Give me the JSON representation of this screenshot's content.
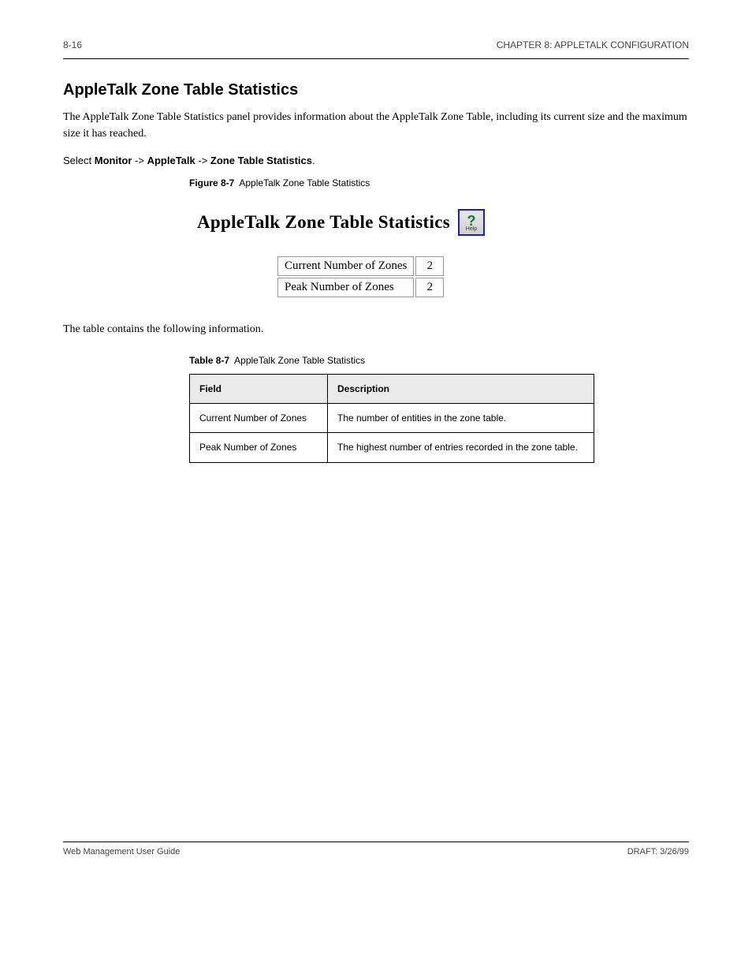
{
  "header": {
    "left": "8-16",
    "right": "CHAPTER 8: APPLETALK CONFIGURATION"
  },
  "section": {
    "title": "AppleTalk Zone Table Statistics",
    "intro": "The AppleTalk Zone Table Statistics panel provides information about the AppleTalk Zone Table, including its current size and the maximum size it has reached.",
    "nav": {
      "prefix": "Select ",
      "m1": "Monitor",
      "arrow": " -> ",
      "m2": "AppleTalk",
      "m3": "Zone Table Statistics"
    }
  },
  "figure": {
    "label": "Figure 8-7",
    "caption": "AppleTalk Zone Table Statistics",
    "panel_title": "AppleTalk Zone Table Statistics",
    "help_label": "Help",
    "rows": [
      {
        "label": "Current Number of Zones",
        "value": "2"
      },
      {
        "label": "Peak Number of Zones",
        "value": "2"
      }
    ]
  },
  "desc_table": {
    "label": "Table 8-7",
    "caption": "AppleTalk Zone Table Statistics",
    "col1": "Field",
    "col2": "Description",
    "rows": [
      {
        "field": "Current Number of Zones",
        "desc": "The number of entities in the zone table."
      },
      {
        "field": "Peak Number of Zones",
        "desc": "The highest number of entries recorded in the zone table."
      }
    ]
  },
  "footer": {
    "left": "Web Management User Guide",
    "right": "DRAFT: 3/26/99"
  }
}
